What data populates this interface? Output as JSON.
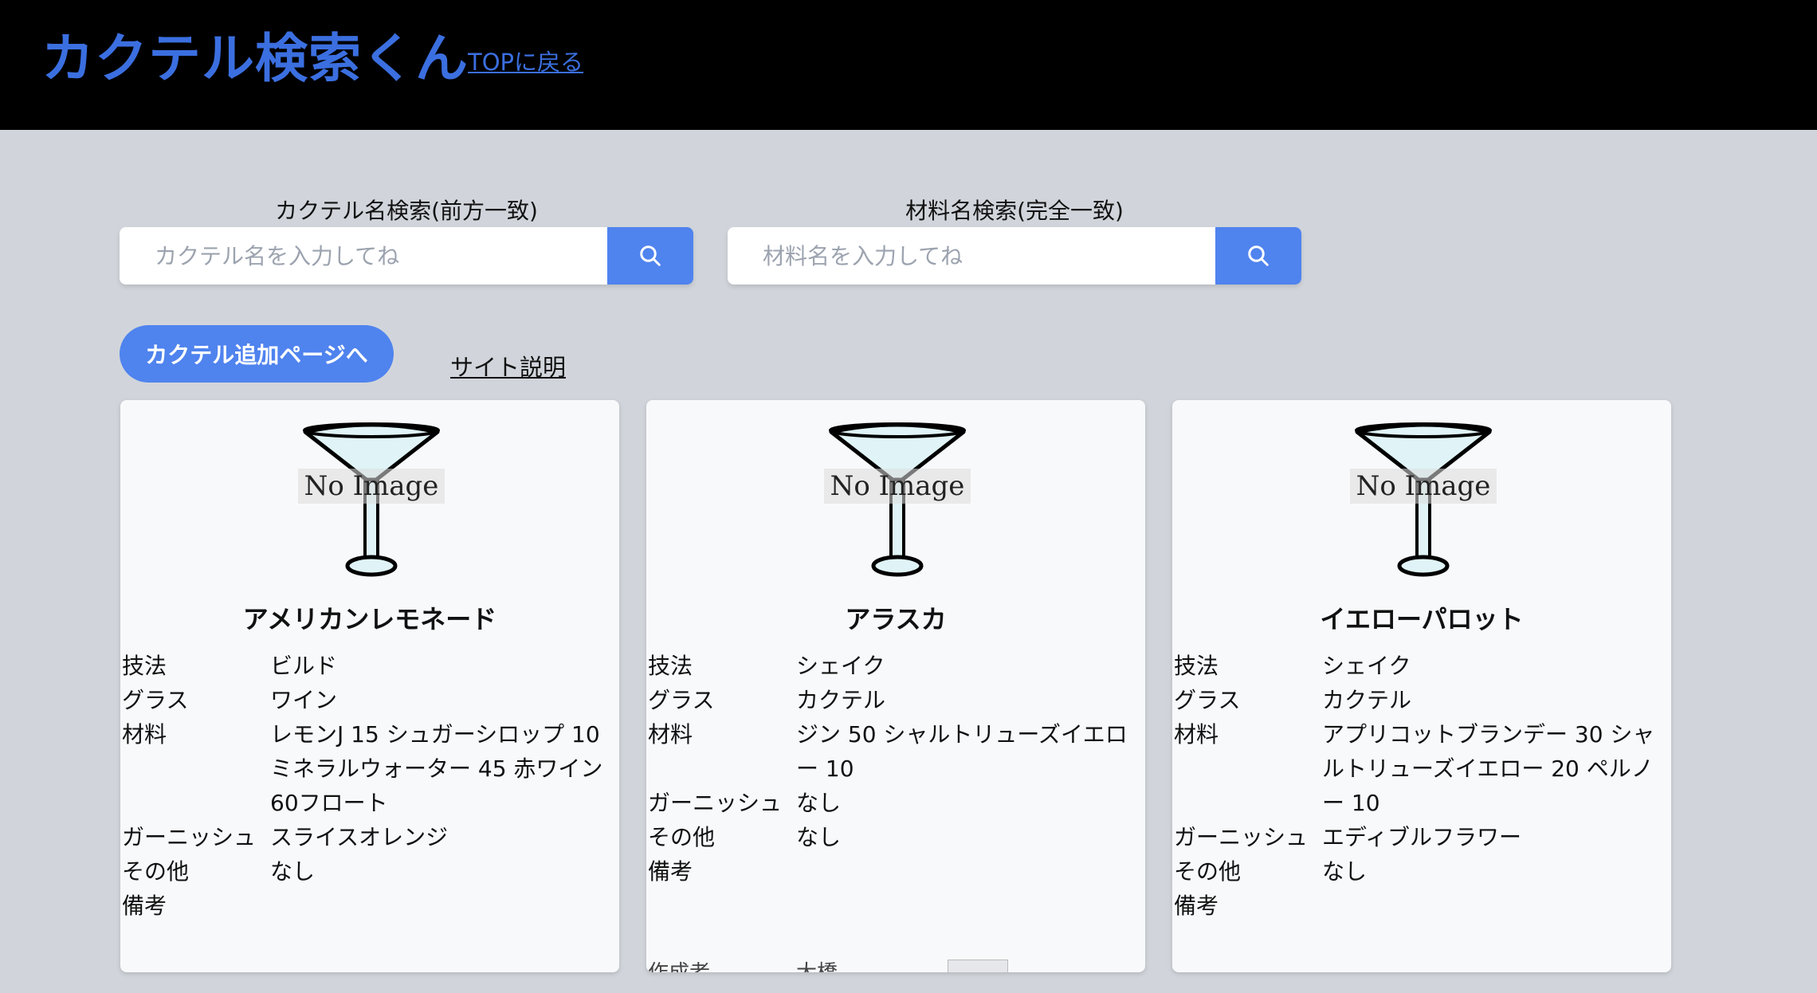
{
  "header": {
    "title": "カクテル検索くん",
    "top_link": "TOPに戻る"
  },
  "search": {
    "name_label": "カクテル名検索(前方一致)",
    "name_placeholder": "カクテル名を入力してね",
    "ingredient_label": "材料名検索(完全一致)",
    "ingredient_placeholder": "材料名を入力してね"
  },
  "actions": {
    "add_button": "カクテル追加ページへ",
    "about_link": "サイト説明"
  },
  "no_image_text": "No Image",
  "labels": {
    "method": "技法",
    "glass": "グラス",
    "ingredients": "材料",
    "garnish": "ガーニッシュ",
    "other": "その他",
    "notes": "備考",
    "author": "作成者"
  },
  "cards": [
    {
      "name": "アメリカンレモネード",
      "method": "ビルド",
      "glass": "ワイン",
      "ingredients": "レモンJ 15 シュガーシロップ 10 ミネラルウォーター 45 赤ワイン 60フロート",
      "garnish": "スライスオレンジ",
      "other": "なし",
      "notes": "",
      "author": ""
    },
    {
      "name": "アラスカ",
      "method": "シェイク",
      "glass": "カクテル",
      "ingredients": "ジン 50 シャルトリューズイエロー 10",
      "garnish": "なし",
      "other": "なし",
      "notes": "",
      "author": "大橋"
    },
    {
      "name": "イエローパロット",
      "method": "シェイク",
      "glass": "カクテル",
      "ingredients": "アプリコットブランデー 30 シャルトリューズイエロー 20 ペルノー 10",
      "garnish": "エディブルフラワー",
      "other": "なし",
      "notes": "",
      "author": ""
    }
  ],
  "colors": {
    "accent": "#4f83ee",
    "title": "#3b6fe0",
    "background": "#d1d5db",
    "header": "#000000"
  }
}
